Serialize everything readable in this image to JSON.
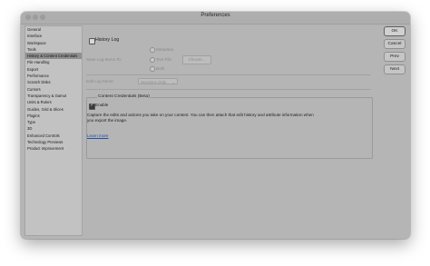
{
  "window": {
    "title": "Preferences"
  },
  "sidebar": {
    "items": [
      {
        "label": "General"
      },
      {
        "label": "Interface"
      },
      {
        "label": "Workspace"
      },
      {
        "label": "Tools"
      },
      {
        "label": "History & Content Credentials"
      },
      {
        "label": "File Handling"
      },
      {
        "label": "Export"
      },
      {
        "label": "Performance"
      },
      {
        "label": "Scratch Disks"
      },
      {
        "label": "Cursors"
      },
      {
        "label": "Transparency & Gamut"
      },
      {
        "label": "Units & Rulers"
      },
      {
        "label": "Guides, Grid & Slices"
      },
      {
        "label": "Plugins"
      },
      {
        "label": "Type"
      },
      {
        "label": "3D"
      },
      {
        "label": "Enhanced Controls"
      },
      {
        "label": "Technology Previews"
      },
      {
        "label": "Product Improvement"
      }
    ],
    "active_index": 4
  },
  "history_log": {
    "label": "History Log",
    "save_items_to_label": "Save Log Items To:",
    "option_metadata": "Metadata",
    "option_text_file": "Text File",
    "option_both": "Both",
    "choose_label": "Choose...",
    "edit_log_items_label": "Edit Log Items:",
    "edit_log_items_value": "Sessions Only"
  },
  "content_credentials": {
    "group_title": "Content Credentials (Beta)",
    "enable_label": "Enable",
    "description": "Capture the edits and actions you take on your content. You can then attach that edit history and attribute information when you export the image.",
    "learn_more": "Learn more"
  },
  "buttons": {
    "ok": "OK",
    "cancel": "Cancel",
    "prev": "Prev",
    "next": "Next"
  }
}
